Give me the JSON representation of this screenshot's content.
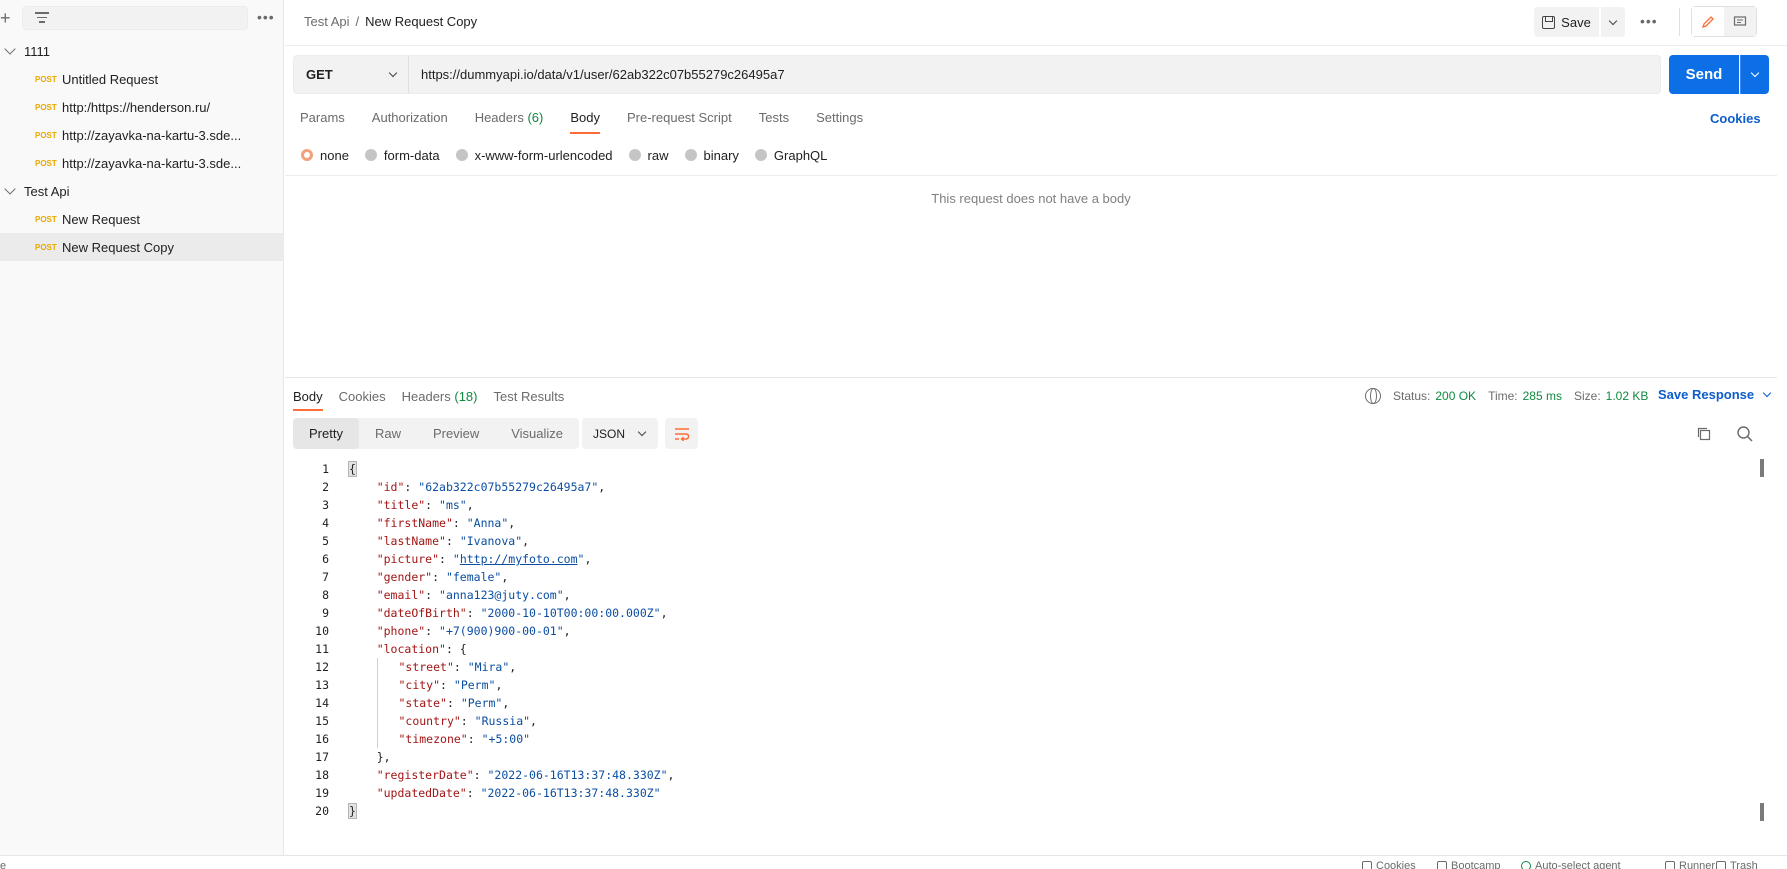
{
  "sidebar": {
    "folders": [
      {
        "name": "1111",
        "requests": [
          {
            "method": "POST",
            "name": "Untitled Request"
          },
          {
            "method": "POST",
            "name": "http:/https://henderson.ru/"
          },
          {
            "method": "POST",
            "name": "http://zayavka-na-kartu-3.sde..."
          },
          {
            "method": "POST",
            "name": "http://zayavka-na-kartu-3.sde..."
          }
        ]
      },
      {
        "name": "Test Api",
        "requests": [
          {
            "method": "POST",
            "name": "New Request"
          },
          {
            "method": "POST",
            "name": "New Request Copy"
          }
        ]
      }
    ]
  },
  "header": {
    "breadcrumb_parent": "Test Api",
    "breadcrumb_sep": "/",
    "title": "New Request Copy",
    "save_label": "Save"
  },
  "request": {
    "method": "GET",
    "url": "https://dummyapi.io/data/v1/user/62ab322c07b55279c26495a7",
    "send_label": "Send",
    "tabs": [
      "Params",
      "Authorization",
      "Headers",
      "Body",
      "Pre-request Script",
      "Tests",
      "Settings"
    ],
    "headers_count": "(6)",
    "cookies_label": "Cookies",
    "body_types": [
      "none",
      "form-data",
      "x-www-form-urlencoded",
      "raw",
      "binary",
      "GraphQL"
    ],
    "no_body_text": "This request does not have a body"
  },
  "response": {
    "tabs": [
      "Body",
      "Cookies",
      "Headers",
      "Test Results"
    ],
    "headers_count": "(18)",
    "status_label": "Status:",
    "status_value": "200 OK",
    "time_label": "Time:",
    "time_value": "285 ms",
    "size_label": "Size:",
    "size_value": "1.02 KB",
    "save_response_label": "Save Response",
    "view_modes": [
      "Pretty",
      "Raw",
      "Preview",
      "Visualize"
    ],
    "format": "JSON",
    "code_lines": [
      [
        {
          "t": "{",
          "c": "brace"
        }
      ],
      [
        {
          "t": "    "
        },
        {
          "t": "\"id\"",
          "c": "k"
        },
        {
          "t": ": "
        },
        {
          "t": "\"62ab322c07b55279c26495a7\"",
          "c": "s"
        },
        {
          "t": ","
        }
      ],
      [
        {
          "t": "    "
        },
        {
          "t": "\"title\"",
          "c": "k"
        },
        {
          "t": ": "
        },
        {
          "t": "\"ms\"",
          "c": "s"
        },
        {
          "t": ","
        }
      ],
      [
        {
          "t": "    "
        },
        {
          "t": "\"firstName\"",
          "c": "k"
        },
        {
          "t": ": "
        },
        {
          "t": "\"Anna\"",
          "c": "s"
        },
        {
          "t": ","
        }
      ],
      [
        {
          "t": "    "
        },
        {
          "t": "\"lastName\"",
          "c": "k"
        },
        {
          "t": ": "
        },
        {
          "t": "\"Ivanova\"",
          "c": "s"
        },
        {
          "t": ","
        }
      ],
      [
        {
          "t": "    "
        },
        {
          "t": "\"picture\"",
          "c": "k"
        },
        {
          "t": ": "
        },
        {
          "t": "\"",
          "c": "s"
        },
        {
          "t": "http://myfoto.com",
          "c": "u"
        },
        {
          "t": "\"",
          "c": "s"
        },
        {
          "t": ","
        }
      ],
      [
        {
          "t": "    "
        },
        {
          "t": "\"gender\"",
          "c": "k"
        },
        {
          "t": ": "
        },
        {
          "t": "\"female\"",
          "c": "s"
        },
        {
          "t": ","
        }
      ],
      [
        {
          "t": "    "
        },
        {
          "t": "\"email\"",
          "c": "k"
        },
        {
          "t": ": "
        },
        {
          "t": "\"anna123@juty.com\"",
          "c": "s"
        },
        {
          "t": ","
        }
      ],
      [
        {
          "t": "    "
        },
        {
          "t": "\"dateOfBirth\"",
          "c": "k"
        },
        {
          "t": ": "
        },
        {
          "t": "\"2000-10-10T00:00:00.000Z\"",
          "c": "s"
        },
        {
          "t": ","
        }
      ],
      [
        {
          "t": "    "
        },
        {
          "t": "\"phone\"",
          "c": "k"
        },
        {
          "t": ": "
        },
        {
          "t": "\"+7(900)900-00-01\"",
          "c": "s"
        },
        {
          "t": ","
        }
      ],
      [
        {
          "t": "    "
        },
        {
          "t": "\"location\"",
          "c": "k"
        },
        {
          "t": ": {"
        }
      ],
      [
        {
          "t": "    "
        },
        {
          "t": "|",
          "c": "g"
        },
        {
          "t": "   "
        },
        {
          "t": "\"street\"",
          "c": "k"
        },
        {
          "t": ": "
        },
        {
          "t": "\"Mira\"",
          "c": "s"
        },
        {
          "t": ","
        }
      ],
      [
        {
          "t": "    "
        },
        {
          "t": "|",
          "c": "g"
        },
        {
          "t": "   "
        },
        {
          "t": "\"city\"",
          "c": "k"
        },
        {
          "t": ": "
        },
        {
          "t": "\"Perm\"",
          "c": "s"
        },
        {
          "t": ","
        }
      ],
      [
        {
          "t": "    "
        },
        {
          "t": "|",
          "c": "g"
        },
        {
          "t": "   "
        },
        {
          "t": "\"state\"",
          "c": "k"
        },
        {
          "t": ": "
        },
        {
          "t": "\"Perm\"",
          "c": "s"
        },
        {
          "t": ","
        }
      ],
      [
        {
          "t": "    "
        },
        {
          "t": "|",
          "c": "g"
        },
        {
          "t": "   "
        },
        {
          "t": "\"country\"",
          "c": "k"
        },
        {
          "t": ": "
        },
        {
          "t": "\"Russia\"",
          "c": "s"
        },
        {
          "t": ","
        }
      ],
      [
        {
          "t": "    "
        },
        {
          "t": "|",
          "c": "g"
        },
        {
          "t": "   "
        },
        {
          "t": "\"timezone\"",
          "c": "k"
        },
        {
          "t": ": "
        },
        {
          "t": "\"+5:00\"",
          "c": "s"
        }
      ],
      [
        {
          "t": "    "
        },
        {
          "t": "},"
        }
      ],
      [
        {
          "t": "    "
        },
        {
          "t": "\"registerDate\"",
          "c": "k"
        },
        {
          "t": ": "
        },
        {
          "t": "\"2022-06-16T13:37:48.330Z\"",
          "c": "s"
        },
        {
          "t": ","
        }
      ],
      [
        {
          "t": "    "
        },
        {
          "t": "\"updatedDate\"",
          "c": "k"
        },
        {
          "t": ": "
        },
        {
          "t": "\"2022-06-16T13:37:48.330Z\"",
          "c": "s"
        }
      ],
      [
        {
          "t": "}",
          "c": "brace"
        }
      ]
    ]
  },
  "footer": {
    "items": [
      "Cookies",
      "Bootcamp",
      "Auto-select agent",
      "Runner",
      "Trash"
    ]
  },
  "colors": {
    "accent": "#ff6c37",
    "primary": "#0d6fe6",
    "success": "#0f8a40",
    "method_post": "#e8a800"
  }
}
